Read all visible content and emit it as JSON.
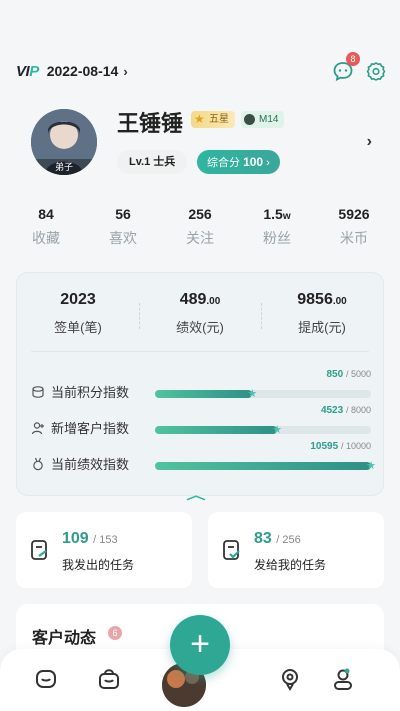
{
  "header": {
    "vip_prefix": "VI",
    "vip_suffix": "P",
    "date": "2022-08-14",
    "date_chevron": "›",
    "message_count": "8"
  },
  "profile": {
    "name": "王锤锤",
    "avatar_tag": "弟子",
    "star_badge": "五星",
    "level_badge": "M14",
    "level_pill": "Lv.1 士兵",
    "score_label": "综合分",
    "score_value": "100",
    "score_chevron": "›",
    "arrow": "›"
  },
  "stats": [
    {
      "num": "84",
      "unit": "",
      "label": "收藏"
    },
    {
      "num": "56",
      "unit": "",
      "label": "喜欢"
    },
    {
      "num": "256",
      "unit": "",
      "label": "关注"
    },
    {
      "num": "1.5",
      "unit": "w",
      "label": "粉丝"
    },
    {
      "num": "5926",
      "unit": "",
      "label": "米币"
    }
  ],
  "performance": {
    "top": [
      {
        "value": "2023",
        "decimal": "",
        "label": "签单(笔)"
      },
      {
        "value": "489",
        "decimal": ".00",
        "label": "绩效(元)"
      },
      {
        "value": "9856",
        "decimal": ".00",
        "label": "提成(元)"
      }
    ],
    "bars": [
      {
        "label": "当前积分指数",
        "value": "850",
        "total": "/ 5000",
        "fraction": 0.45
      },
      {
        "label": "新增客户指数",
        "value": "4523",
        "total": "/ 8000",
        "fraction": 0.565
      },
      {
        "label": "当前绩效指数",
        "value": "10595",
        "total": "/ 10000",
        "fraction": 1.0
      }
    ],
    "collapse_icon": "︿"
  },
  "tasks": [
    {
      "count": "109",
      "total": "/ 153",
      "label": "我发出的任务"
    },
    {
      "count": "83",
      "total": "/ 256",
      "label": "发给我的任务"
    }
  ],
  "customer": {
    "title": "客户动态",
    "badge": "6"
  },
  "nav": {
    "fab": "+"
  },
  "colors": {
    "accent": "#2fa795",
    "accent_light": "#4fc39f",
    "badge_red": "#e85a5a",
    "gold": "#f4d98a"
  }
}
